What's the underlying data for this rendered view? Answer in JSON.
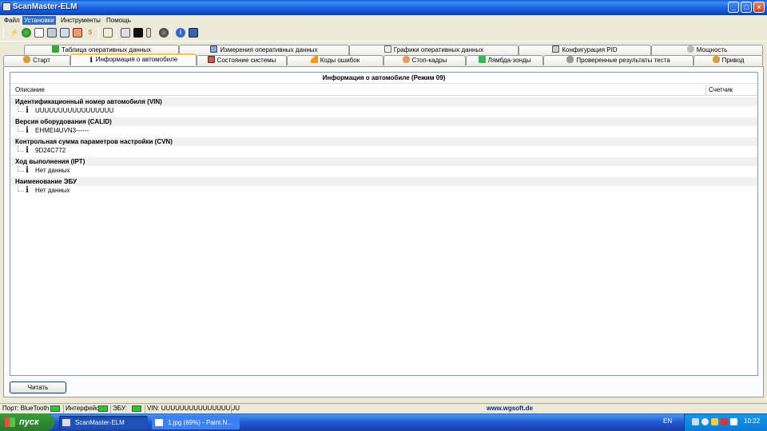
{
  "window": {
    "title": "ScanMaster-ELM"
  },
  "menu": [
    {
      "label": "Файл",
      "active": false
    },
    {
      "label": "Установки",
      "active": true
    },
    {
      "label": "Инструменты",
      "active": false
    },
    {
      "label": "Помощь",
      "active": false
    }
  ],
  "tabs_row1": [
    {
      "label": "Таблица оперативных данных",
      "icon": "table-icon"
    },
    {
      "label": "Измерения оперативных данных",
      "icon": "gauge-icon"
    },
    {
      "label": "Графики оперативных данных",
      "icon": "graph-icon"
    },
    {
      "label": "Конфигурация PID",
      "icon": "config-icon"
    },
    {
      "label": "Мощность",
      "icon": "power-icon"
    }
  ],
  "tabs_row2": [
    {
      "label": "Старт",
      "icon": "start-icon"
    },
    {
      "label": "Информация о автомобиле",
      "icon": "info-icon"
    },
    {
      "label": "Состояние системы",
      "icon": "status-icon"
    },
    {
      "label": "Коды ошибок",
      "icon": "warning-icon"
    },
    {
      "label": "Стоп-кадры",
      "icon": "freeze-frame-icon"
    },
    {
      "label": "Лямбда-зонды",
      "icon": "lambda-icon"
    },
    {
      "label": "Проверенные результаты теста",
      "icon": "gear-icon"
    },
    {
      "label": "Привод",
      "icon": "drive-icon"
    }
  ],
  "panel": {
    "title": "Информация о автомобиле (Режим 09)",
    "col_description": "Описание",
    "col_counter": "Счетчик",
    "groups": [
      {
        "label": "Идентификационный номер автомобиля (VIN)",
        "value": "UUUUUUUUUUUUUUUUU"
      },
      {
        "label": "Версия оборудования (CALID)",
        "value": "EHMEI4UVN3------"
      },
      {
        "label": "Контрольная сумма параметров настройки (CVN)",
        "value": "9D24C772"
      },
      {
        "label": "Ход выполнения (IPT)",
        "value": "Нет данных"
      },
      {
        "label": "Наименование ЭБУ",
        "value": "Нет данных"
      }
    ],
    "read_button": "Читать"
  },
  "statusbar": {
    "port": "Порт: BlueTooth",
    "interface": "Интерфейс:",
    "ecu": "ЭБУ:",
    "vin": "VIN: UUUUUUUUUUUUUUUUU",
    "url": "www.wgsoft.de",
    "led_color": "#22cc22"
  },
  "taskbar": {
    "start": "пуск",
    "tasks": [
      "ScanMaster-ELM",
      "1.jpg (69%) - Paint.N..."
    ],
    "lang": "EN",
    "clock": "10:22"
  }
}
